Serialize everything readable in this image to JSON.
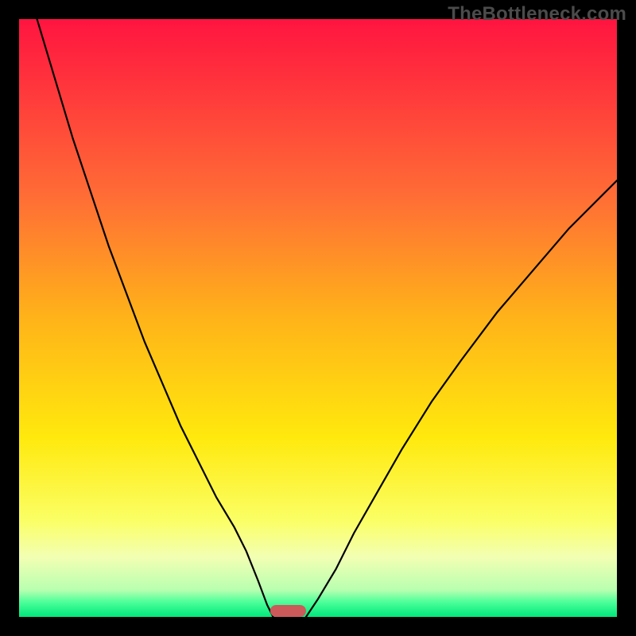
{
  "watermark": "TheBottleneck.com",
  "chart_data": {
    "type": "line",
    "title": "",
    "xlabel": "",
    "ylabel": "",
    "xlim": [
      0,
      100
    ],
    "ylim": [
      0,
      100
    ],
    "grid": false,
    "legend": false,
    "background": {
      "kind": "vertical-gradient",
      "stops": [
        {
          "pos": 0.0,
          "color": "#ff1440"
        },
        {
          "pos": 0.3,
          "color": "#ff6e35"
        },
        {
          "pos": 0.5,
          "color": "#ffb319"
        },
        {
          "pos": 0.7,
          "color": "#ffe90d"
        },
        {
          "pos": 0.84,
          "color": "#fbff66"
        },
        {
          "pos": 0.9,
          "color": "#f2ffb3"
        },
        {
          "pos": 0.955,
          "color": "#b8ffb0"
        },
        {
          "pos": 0.975,
          "color": "#4dff9a"
        },
        {
          "pos": 1.0,
          "color": "#00e87a"
        }
      ]
    },
    "series": [
      {
        "name": "left-curve",
        "color": "#000000",
        "width": 2.2,
        "x": [
          3,
          6,
          9,
          12,
          15,
          18,
          21,
          24,
          27,
          30,
          33,
          36,
          38,
          40,
          41.5,
          42.5
        ],
        "y": [
          100,
          90,
          80,
          71,
          62,
          54,
          46,
          39,
          32,
          26,
          20,
          15,
          11,
          6,
          2,
          0
        ]
      },
      {
        "name": "right-curve",
        "color": "#000000",
        "width": 2.2,
        "x": [
          48,
          50,
          53,
          56,
          60,
          64,
          69,
          74,
          80,
          86,
          92,
          98,
          100
        ],
        "y": [
          0,
          3,
          8,
          14,
          21,
          28,
          36,
          43,
          51,
          58,
          65,
          71,
          73
        ]
      }
    ],
    "marker": {
      "name": "bottleneck-marker",
      "shape": "capsule",
      "color": "#cc5a5a",
      "x_center": 45,
      "y": 0,
      "width_x": 6,
      "height_y": 2
    }
  }
}
